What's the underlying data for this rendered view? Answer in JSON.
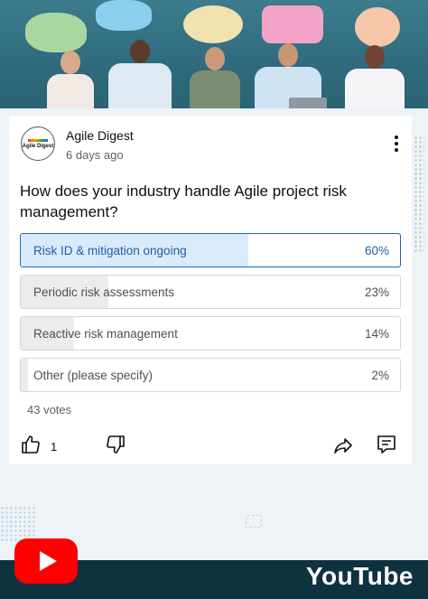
{
  "post": {
    "channel_name": "Agile Digest",
    "avatar_text": "Agile Digest",
    "time_ago": "6 days ago",
    "question": "How does your industry handle Agile project risk management?",
    "options": [
      {
        "label": "Risk ID & mitigation ongoing",
        "percent": "60%",
        "share": 60,
        "selected": true
      },
      {
        "label": "Periodic risk assessments",
        "percent": "23%",
        "share": 23,
        "selected": false
      },
      {
        "label": "Reactive risk management",
        "percent": "14%",
        "share": 14,
        "selected": false
      },
      {
        "label": "Other (please specify)",
        "percent": "2%",
        "share": 2,
        "selected": false
      }
    ],
    "votes": "43 votes",
    "like_count": "1"
  },
  "icons": {
    "like": "thumbs-up-icon",
    "dislike": "thumbs-down-icon",
    "share": "share-icon",
    "comment": "comment-icon",
    "more": "more-vertical-icon"
  },
  "footer": {
    "brand": "YouTube"
  },
  "colors": {
    "selected_border": "#1f67b4",
    "selected_fill": "#d9ebfb",
    "unselected_fill": "#ececec",
    "footer_bg": "#0e3240",
    "logo_red": "#ff0000"
  }
}
